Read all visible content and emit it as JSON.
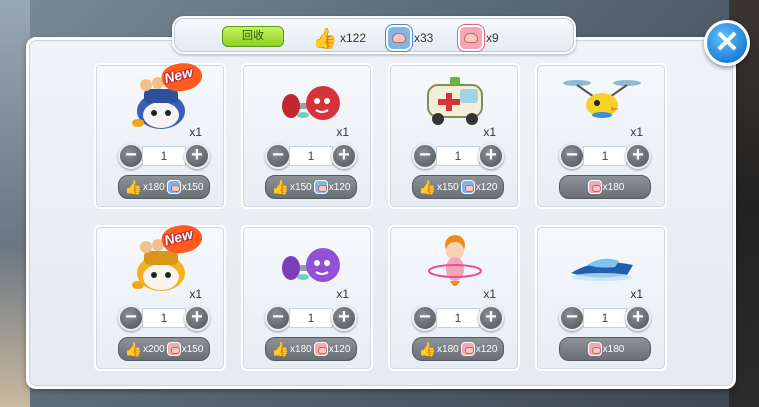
{
  "topbar": {
    "recycle_label": "回收",
    "currencies": [
      {
        "icon": "thumbs-up-icon",
        "amount": "x122"
      },
      {
        "icon": "blue-muscle-box-icon",
        "amount": "x33"
      },
      {
        "icon": "pink-muscle-box-icon",
        "amount": "x9"
      }
    ]
  },
  "close_label": "✕",
  "colors": {
    "accent_blue": "#1f7fd6",
    "recycle_green": "#8fd12a",
    "panel_bg": "#e9eff5"
  },
  "items": [
    {
      "art": "blue-robot-pet",
      "new": true,
      "new_label": "New",
      "qty": "x1",
      "count": "1",
      "price": [
        {
          "icon": "thumbs-up-icon",
          "amount": "x180"
        },
        {
          "icon": "blue-muscle-box-icon",
          "amount": "x150"
        }
      ]
    },
    {
      "art": "red-dumbbell",
      "new": false,
      "qty": "x1",
      "count": "1",
      "price": [
        {
          "icon": "thumbs-up-icon",
          "amount": "x150"
        },
        {
          "icon": "blue-muscle-box-icon",
          "amount": "x120"
        }
      ]
    },
    {
      "art": "ambulance-car",
      "new": false,
      "qty": "x1",
      "count": "1",
      "price": [
        {
          "icon": "thumbs-up-icon",
          "amount": "x150"
        },
        {
          "icon": "blue-muscle-box-icon",
          "amount": "x120"
        }
      ]
    },
    {
      "art": "drone-bird",
      "new": false,
      "qty": "x1",
      "count": "1",
      "price": [
        {
          "icon": "pink-muscle-box-icon",
          "amount": "x180"
        }
      ]
    },
    {
      "art": "yellow-robot-pet",
      "new": true,
      "new_label": "New",
      "qty": "x1",
      "count": "1",
      "price": [
        {
          "icon": "thumbs-up-icon",
          "amount": "x200"
        },
        {
          "icon": "pink-muscle-box-icon",
          "amount": "x150"
        }
      ]
    },
    {
      "art": "purple-dumbbell",
      "new": false,
      "qty": "x1",
      "count": "1",
      "price": [
        {
          "icon": "thumbs-up-icon",
          "amount": "x180"
        },
        {
          "icon": "pink-muscle-box-icon",
          "amount": "x120"
        }
      ]
    },
    {
      "art": "hula-hoop-girl",
      "new": false,
      "qty": "x1",
      "count": "1",
      "price": [
        {
          "icon": "thumbs-up-icon",
          "amount": "x180"
        },
        {
          "icon": "pink-muscle-box-icon",
          "amount": "x120"
        }
      ]
    },
    {
      "art": "jet-ski",
      "new": false,
      "qty": "x1",
      "count": "1",
      "price": [
        {
          "icon": "pink-muscle-box-icon",
          "amount": "x180"
        }
      ]
    }
  ]
}
